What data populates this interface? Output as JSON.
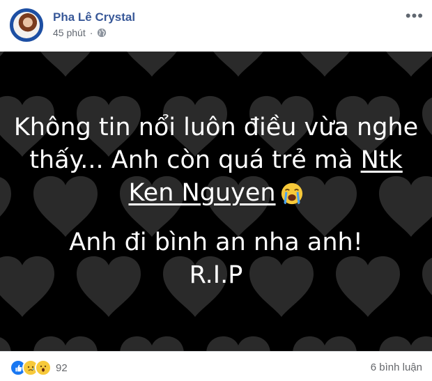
{
  "post": {
    "author": "Pha Lê Crystal",
    "time": "45 phút",
    "privacy_icon": "globe-icon",
    "more_icon": "more-icon"
  },
  "image": {
    "background": "#000000",
    "heart_color": "#2a2a2a",
    "line1": "Không tin nổi luôn điều vừa nghe",
    "line2a": "thấy... Anh còn quá trẻ mà ",
    "line2b": "Ntk",
    "line3": "Ken Nguyen",
    "emoji": "crying-face-icon",
    "line4": "Anh đi bình an nha anh!",
    "line5": "R.I.P"
  },
  "footer": {
    "reactions": [
      "like-icon",
      "sad-icon",
      "wow-icon"
    ],
    "reaction_count": "92",
    "comments": "6 bình luận"
  }
}
